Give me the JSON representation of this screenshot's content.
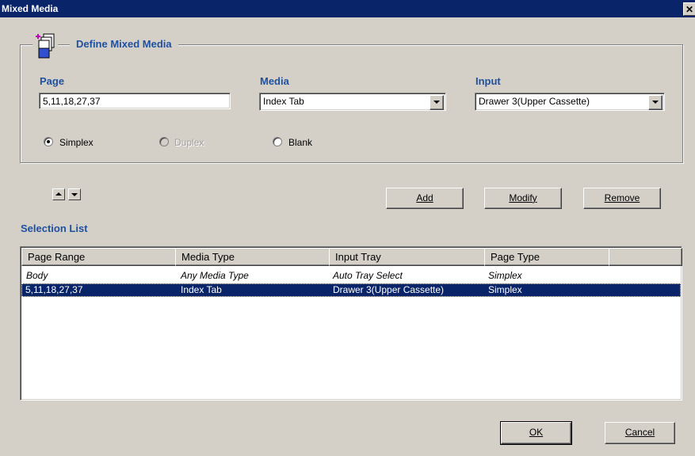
{
  "window": {
    "title": "Mixed Media",
    "close_glyph": "✕"
  },
  "group": {
    "title": "Define Mixed Media",
    "icon": "mixed-media-pages-icon"
  },
  "page_field": {
    "label": "Page",
    "value": "5,11,18,27,37"
  },
  "media_field": {
    "label": "Media",
    "value": "Index Tab"
  },
  "input_field": {
    "label": "Input",
    "value": "Drawer 3(Upper Cassette)"
  },
  "radios": {
    "simplex": "Simplex",
    "duplex": "Duplex",
    "blank": "Blank",
    "selected": "simplex"
  },
  "buttons": {
    "add": "Add",
    "modify": "Modify",
    "remove": "Remove",
    "ok": "OK",
    "cancel": "Cancel"
  },
  "selection_list": {
    "label": "Selection List",
    "columns": [
      "Page Range",
      "Media Type",
      "Input Tray",
      "Page Type"
    ],
    "rows": [
      {
        "page_range": "Body",
        "media_type": "Any Media Type",
        "input_tray": "Auto Tray Select",
        "page_type": "Simplex",
        "selected": false
      },
      {
        "page_range": "5,11,18,27,37",
        "media_type": "Index Tab",
        "input_tray": "Drawer 3(Upper Cassette)",
        "page_type": "Simplex",
        "selected": true
      }
    ]
  },
  "colors": {
    "titlebar": "#0a246a",
    "label": "#2050a0",
    "face": "#d4d0c8",
    "selection": "#0a246a"
  }
}
